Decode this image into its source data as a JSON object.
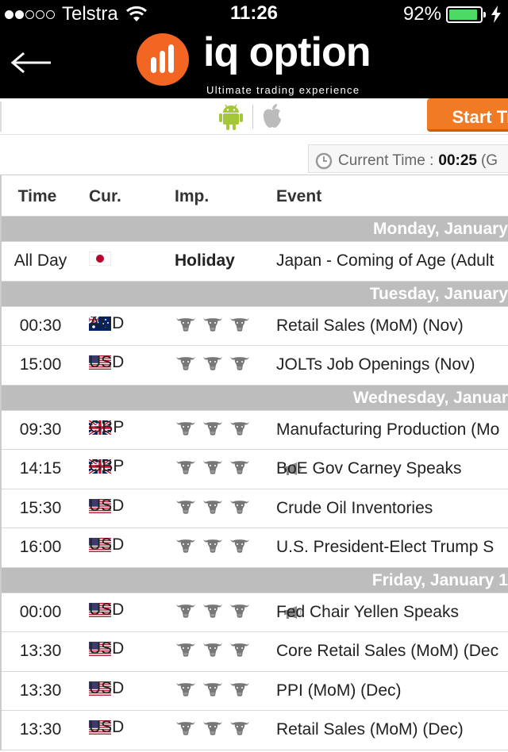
{
  "status_bar": {
    "carrier": "Telstra",
    "time": "11:26",
    "battery": "92%",
    "battery_level": 0.92,
    "battery_color": "#4cd964"
  },
  "header": {
    "logo_text": "iq option",
    "tagline": "Ultimate trading experience",
    "brand_color": "#f26522"
  },
  "appbar": {
    "start_button": "Start Tr"
  },
  "current_time": {
    "label": "Current Time :",
    "value": "00:25",
    "suffix": "(G"
  },
  "columns": {
    "time": "Time",
    "cur": "Cur.",
    "imp": "Imp.",
    "event": "Event"
  },
  "days": [
    {
      "label": "Monday, January",
      "rows": [
        {
          "time": "All Day",
          "flag": "JP",
          "cur": "",
          "imp": "Holiday",
          "event": "Japan - Coming of Age (Adult"
        }
      ]
    },
    {
      "label": "Tuesday, January",
      "rows": [
        {
          "time": "00:30",
          "flag": "AU",
          "cur": "AUD",
          "imp": "bulls-3",
          "event": "Retail Sales (MoM) (Nov)"
        },
        {
          "time": "15:00",
          "flag": "US",
          "cur": "USD",
          "imp": "bulls-3",
          "event": "JOLTs Job Openings (Nov)"
        }
      ]
    },
    {
      "label": "Wednesday, Januar",
      "rows": [
        {
          "time": "09:30",
          "flag": "GB",
          "cur": "GBP",
          "imp": "bulls-3",
          "event": "Manufacturing Production (Mo"
        },
        {
          "time": "14:15",
          "flag": "GB",
          "cur": "GBP",
          "imp": "bulls-3",
          "event": "BoE Gov Carney Speaks",
          "speech": true
        },
        {
          "time": "15:30",
          "flag": "US",
          "cur": "USD",
          "imp": "bulls-3",
          "event": "Crude Oil Inventories"
        },
        {
          "time": "16:00",
          "flag": "US",
          "cur": "USD",
          "imp": "bulls-3",
          "event": "U.S. President-Elect Trump S"
        }
      ]
    },
    {
      "label": "Friday, January 1",
      "rows": [
        {
          "time": "00:00",
          "flag": "US",
          "cur": "USD",
          "imp": "bulls-3",
          "event": "Fed Chair Yellen Speaks",
          "speech": true
        },
        {
          "time": "13:30",
          "flag": "US",
          "cur": "USD",
          "imp": "bulls-3",
          "event": "Core Retail Sales (MoM) (Dec"
        },
        {
          "time": "13:30",
          "flag": "US",
          "cur": "USD",
          "imp": "bulls-3",
          "event": "PPI (MoM) (Dec)"
        },
        {
          "time": "13:30",
          "flag": "US",
          "cur": "USD",
          "imp": "bulls-3",
          "event": "Retail Sales (MoM) (Dec)"
        }
      ]
    }
  ]
}
